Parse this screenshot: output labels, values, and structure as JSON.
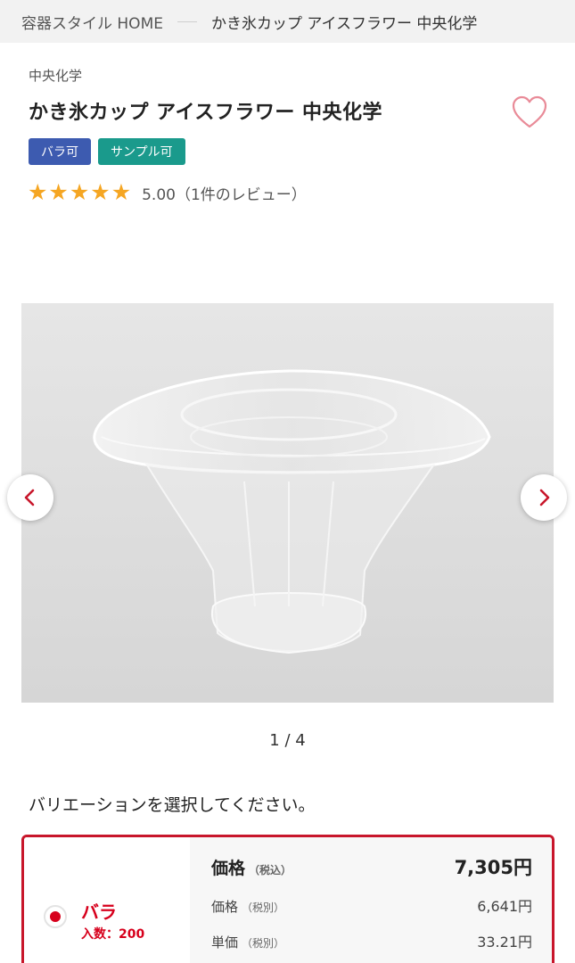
{
  "breadcrumb": {
    "home": "容器スタイル HOME",
    "current": "かき氷カップ アイスフラワー 中央化学"
  },
  "product": {
    "maker": "中央化学",
    "title": "かき氷カップ アイスフラワー 中央化学",
    "badges": [
      "バラ可",
      "サンプル可"
    ],
    "rating_text": "5.00（1件のレビュー）",
    "rating": 5
  },
  "gallery": {
    "counter": "1 / 4"
  },
  "variation": {
    "prompt": "バリエーションを選択してください。",
    "option": {
      "name": "バラ",
      "quantity": "入数：200",
      "price_label": "価格",
      "price_tax_in_note": "（税込）",
      "price_tax_in": "7,305円",
      "price_tax_ex_label": "価格",
      "price_tax_ex_note": "（税別）",
      "price_tax_ex": "6,641円",
      "unit_label": "単価",
      "unit_note": "（税別）",
      "unit_price": "33.21円"
    }
  },
  "colors": {
    "accent": "#d7001c",
    "badge_blue": "#3d5bb0",
    "badge_teal": "#1a9a8c",
    "star": "#f5a623"
  },
  "icons": {
    "favorite": "heart-outline-icon",
    "prev": "chevron-left-icon",
    "next": "chevron-right-icon",
    "star": "star-icon"
  }
}
